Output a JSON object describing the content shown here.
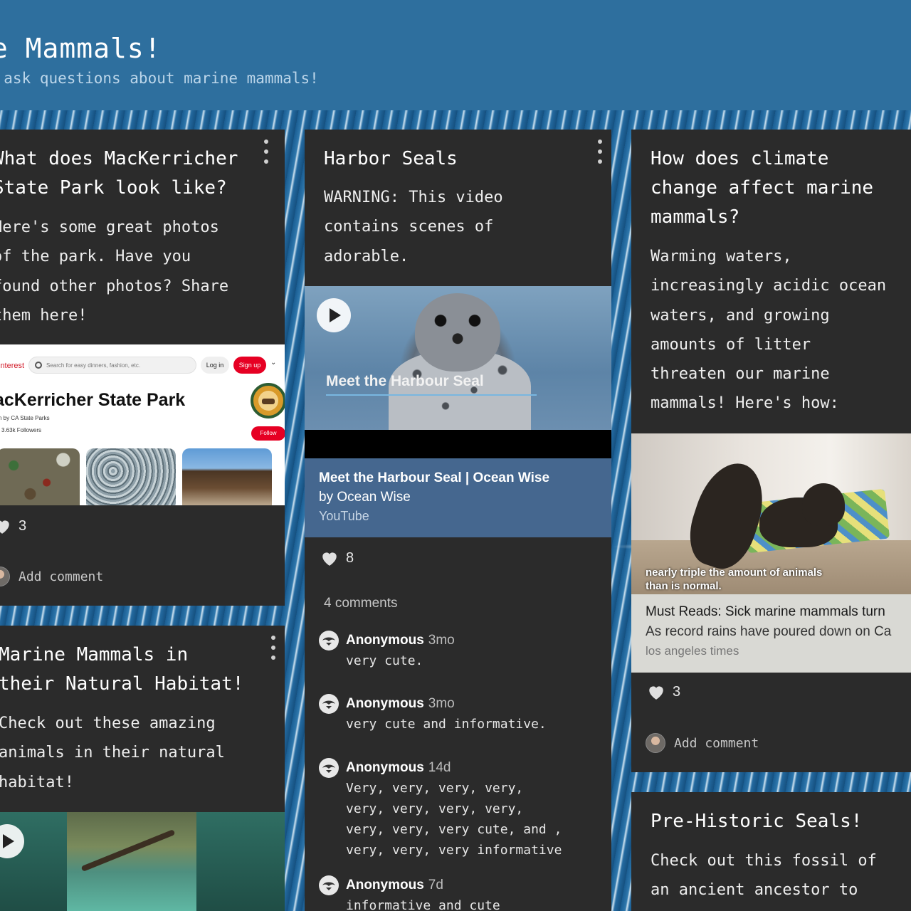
{
  "header": {
    "title": "ne Mammals!",
    "subtitle": "d ask questions about marine mammals!"
  },
  "cards": {
    "mackerricher": {
      "title_lines": [
        "What does MacKerricher",
        "State Park look like?"
      ],
      "body_lines": [
        "Here's some great photos",
        "of the park. Have you",
        "found other photos? Share",
        "them here!"
      ],
      "preview": {
        "logo": "interest",
        "search_placeholder": "Search for easy dinners, fashion, etc.",
        "login": "Log in",
        "signup": "Sign up",
        "board_title": "acKerricher State Park",
        "by": "n by CA State Parks",
        "followers": "3.63k Followers",
        "follow": "Follow",
        "badge": "CALIFORNIA STATE PARKS"
      },
      "likes": "3",
      "add_comment": "Add comment"
    },
    "harbor": {
      "title": "Harbor Seals",
      "body_lines": [
        "WARNING: This video",
        "contains scenes of",
        "adorable."
      ],
      "video_caption": "Meet the Harbour Seal",
      "yt_title": "Meet the Harbour Seal | Ocean Wise",
      "yt_by": "by Ocean Wise",
      "yt_source": "YouTube",
      "likes": "8",
      "comment_count": "4 comments",
      "comments": [
        {
          "author": "Anonymous",
          "time": "3mo",
          "text": "very cute."
        },
        {
          "author": "Anonymous",
          "time": "3mo",
          "text": "very cute and informative."
        },
        {
          "author": "Anonymous",
          "time": "14d",
          "text": "Very, very, very, very,\nvery, very, very, very,\nvery, very, very cute, and ,\nvery, very, very informative"
        },
        {
          "author": "Anonymous",
          "time": "7d",
          "text": "informative and cute"
        }
      ]
    },
    "climate": {
      "title_lines": [
        "How does climate",
        "change affect marine",
        "mammals?"
      ],
      "body_lines": [
        "Warming waters,",
        "increasingly acidic ocean",
        "waters, and growing",
        "amounts of litter",
        "threaten our marine",
        "mammals! Here's how:"
      ],
      "image_overlay": [
        "nearly triple the amount of animals",
        "than is normal."
      ],
      "article_title": "Must Reads: Sick marine mammals turn",
      "article_desc": "As record rains have poured down on Ca",
      "article_source": "los angeles times",
      "likes": "3",
      "add_comment": "Add comment"
    },
    "habitat": {
      "title_lines": [
        "Marine Mammals in",
        "their Natural Habitat!"
      ],
      "body_lines": [
        "Check out these amazing",
        "animals in their natural",
        "habitat!"
      ]
    },
    "prehistoric": {
      "title": "Pre-Historic Seals!",
      "body_lines": [
        "Check out this fossil of",
        "an ancient ancestor to"
      ]
    }
  },
  "colors": {
    "header_bg": "#2e6f9e",
    "card_bg": "#2b2b2b",
    "youtube_info_bg": "#45678f",
    "pinterest_red": "#e60023"
  },
  "icons": [
    "more-vert-icon",
    "heart-icon",
    "play-icon",
    "avatar-icon",
    "anonymous-avatar-icon",
    "search-icon",
    "chevron-down-icon"
  ]
}
